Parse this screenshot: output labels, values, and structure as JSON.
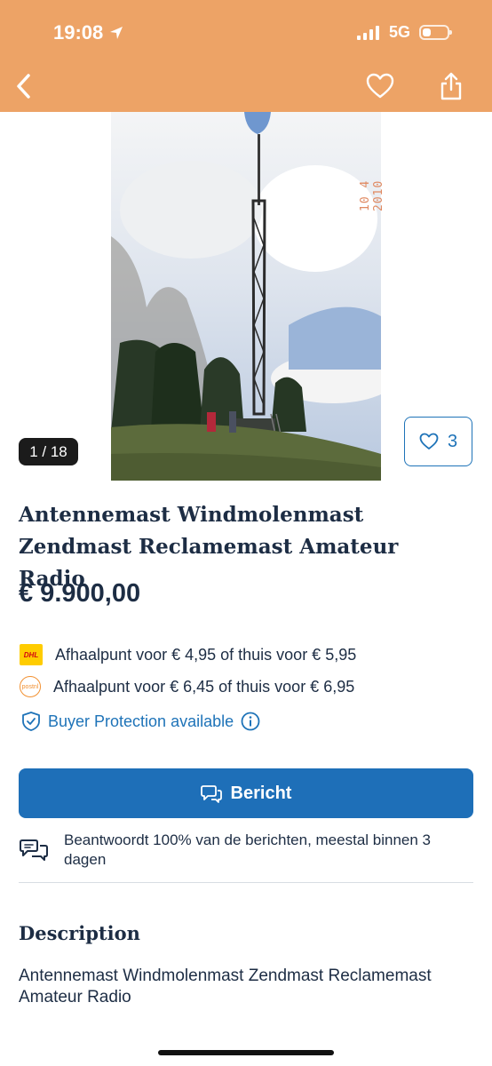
{
  "status_bar": {
    "time": "19:08",
    "network": "5G"
  },
  "nav": {
    "back_icon": "chevron-left-icon",
    "favorite_icon": "heart-icon",
    "share_icon": "share-icon"
  },
  "photo": {
    "counter": "1 / 18",
    "date_stamp": "10 4 2010",
    "favorites_count": "3"
  },
  "item": {
    "title": "Antennemast Windmolenmast Zendmast Reclamemast Amateur Radio",
    "price": "€ 9.900,00"
  },
  "shipping": [
    {
      "carrier_logo": "DHL",
      "text": "Afhaalpunt voor € 4,95 of thuis voor € 5,95"
    },
    {
      "carrier_logo": "postnl",
      "text": "Afhaalpunt voor € 6,45 of thuis voor € 6,95"
    }
  ],
  "protection": {
    "label": "Buyer Protection available"
  },
  "message_button": {
    "label": "Bericht"
  },
  "response_info": {
    "text": "Beantwoordt 100% van de berichten, meestal binnen 3 dagen"
  },
  "description": {
    "heading": "Description",
    "text": "Antennemast Windmolenmast Zendmast Reclamemast Amateur Radio"
  },
  "colors": {
    "header": "#eda366",
    "accent": "#1e73b8",
    "button": "#1e6fb8",
    "text": "#1d2d44"
  }
}
